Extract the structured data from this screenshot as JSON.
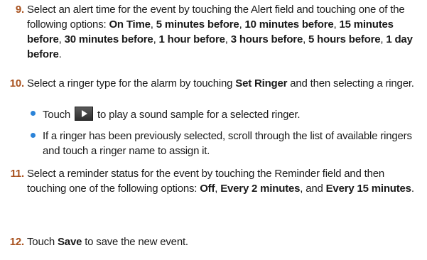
{
  "steps": [
    {
      "number": "9.",
      "t0": "Select an alert time for the event by touching the Alert field and touching one of the following options: ",
      "o1": "On Time",
      "s1": ",  ",
      "o2": "5 minutes before",
      "s2": ", ",
      "o3": "10 minutes before",
      "s3": ", ",
      "o4": "15 minutes before",
      "s4": ", ",
      "o5": "30 minutes before",
      "s5": ", ",
      "o6": "1 hour before",
      "s6": ", ",
      "o7": "3 hours before",
      "s7": ", ",
      "o8": "5 hours before",
      "s8": ", ",
      "o9": "1 day before",
      "s9": "."
    },
    {
      "number": "10.",
      "t0": "Select a ringer type for the alarm by touching ",
      "b1": "Set Ringer",
      "t1": " and then selecting a ringer."
    },
    {
      "number": "11.",
      "t0": "Select a reminder status for the event by touching the Reminder field and then touching one of the following options: ",
      "o1": "Off",
      "s1": ", ",
      "o2": "Every 2 minutes",
      "s2": ", and ",
      "o3": "Every 15 minutes",
      "s3": "."
    },
    {
      "number": "12.",
      "t0": "Touch ",
      "b1": "Save",
      "t1": " to save the new event."
    }
  ],
  "bullets": [
    {
      "before": "Touch",
      "icon": "play-icon",
      "after": "to play a sound sample for a selected ringer."
    },
    {
      "text": "If a ringer has been previously selected, scroll through the list of available ringers and touch a ringer name to assign it."
    }
  ],
  "colors": {
    "step_number": "#a8521f",
    "bullet": "#2b83d8",
    "text": "#1a1a1a"
  }
}
